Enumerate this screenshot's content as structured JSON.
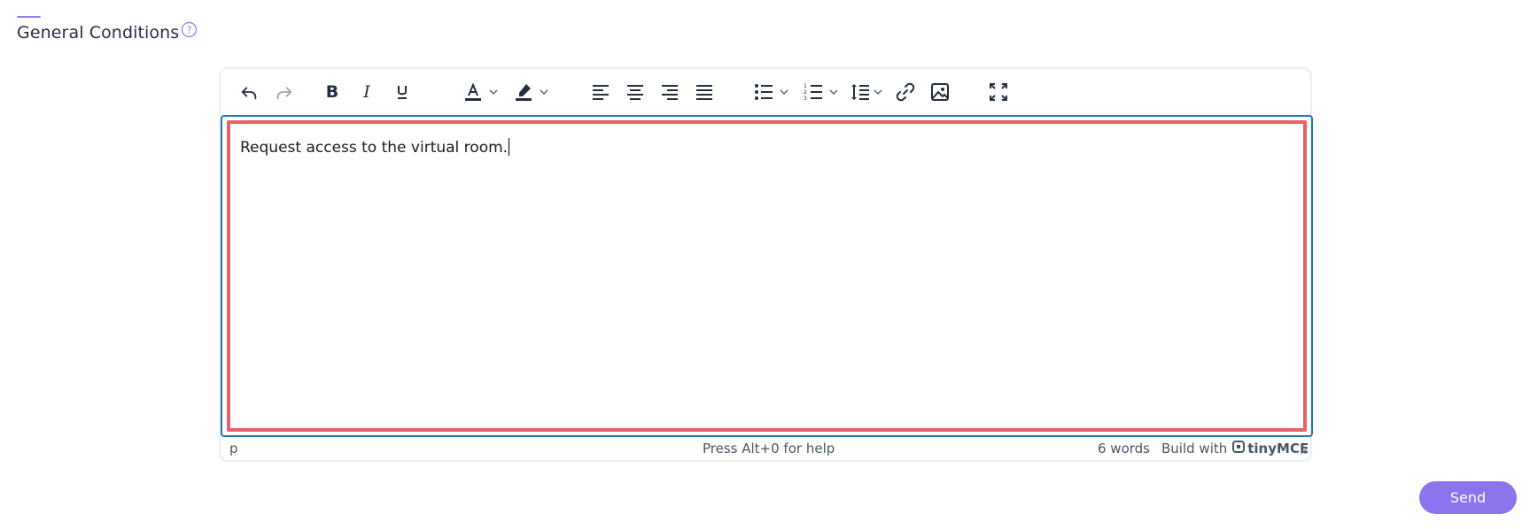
{
  "section": {
    "title": "General Conditions",
    "help_icon": "question-circle-icon",
    "accent_color": "#8d7cf3"
  },
  "editor": {
    "toolbar": [
      {
        "icon": "undo-icon"
      },
      {
        "icon": "redo-icon"
      },
      {
        "icon": "bold-icon"
      },
      {
        "icon": "italic-icon"
      },
      {
        "icon": "underline-icon"
      },
      {
        "icon": "text-color-icon"
      },
      {
        "icon": "highlight-color-icon"
      },
      {
        "icon": "align-left-icon"
      },
      {
        "icon": "align-center-icon"
      },
      {
        "icon": "align-right-icon"
      },
      {
        "icon": "align-justify-icon"
      },
      {
        "icon": "bullet-list-icon"
      },
      {
        "icon": "numbered-list-icon"
      },
      {
        "icon": "line-height-icon"
      },
      {
        "icon": "link-icon"
      },
      {
        "icon": "image-icon"
      },
      {
        "icon": "fullscreen-icon"
      }
    ],
    "content": "Request access to the virtual room.",
    "focus_color": "#207ab7",
    "highlight_color": "#ec5f67",
    "statusbar": {
      "path": "p",
      "help": "Press Alt+0 for help",
      "word_count": "6 words",
      "brand_prefix": "Build with",
      "brand_name": "tinyMCE"
    }
  },
  "actions": {
    "send_label": "Send",
    "send_color": "#8d73ee"
  }
}
